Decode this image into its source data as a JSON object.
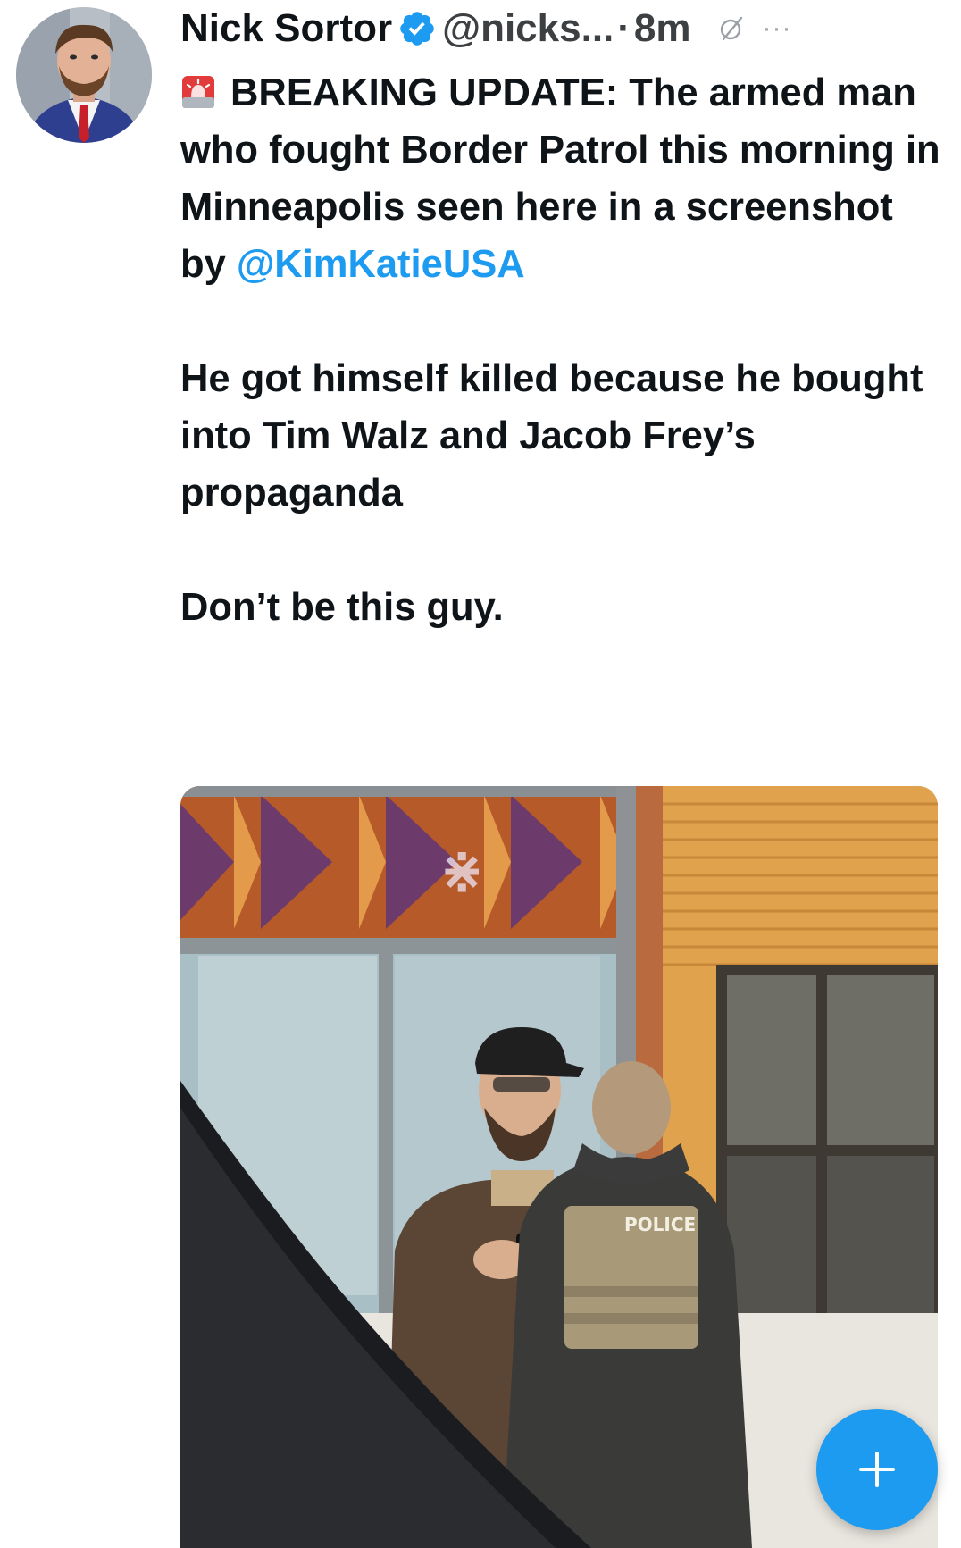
{
  "tweet": {
    "author": {
      "display_name": "Nick Sortor",
      "handle": "@nicks...",
      "verified": true
    },
    "separator": "·",
    "time": "8m",
    "more_label": "···",
    "paragraph1": {
      "text_before": "BREAKING UPDATE: The armed man who fought Border Patrol this morning in Minneapolis seen here in a screenshot by ",
      "mention": "@KimKatieUSA"
    },
    "paragraph2": "He got himself killed because he bought into Tim Walz and Jacob Frey’s propaganda",
    "paragraph3": "Don’t be this guy.",
    "media": {
      "vest_text": "POLICE"
    }
  },
  "fab": {
    "label": "+"
  },
  "colors": {
    "accent": "#1d9bf0",
    "text": "#0f1419",
    "secondary": "#3c4043"
  },
  "icons": {
    "verified": "verified-badge-icon",
    "grok": "grok-icon",
    "more": "more-icon",
    "siren": "siren-emoji-icon",
    "compose": "plus-icon"
  }
}
